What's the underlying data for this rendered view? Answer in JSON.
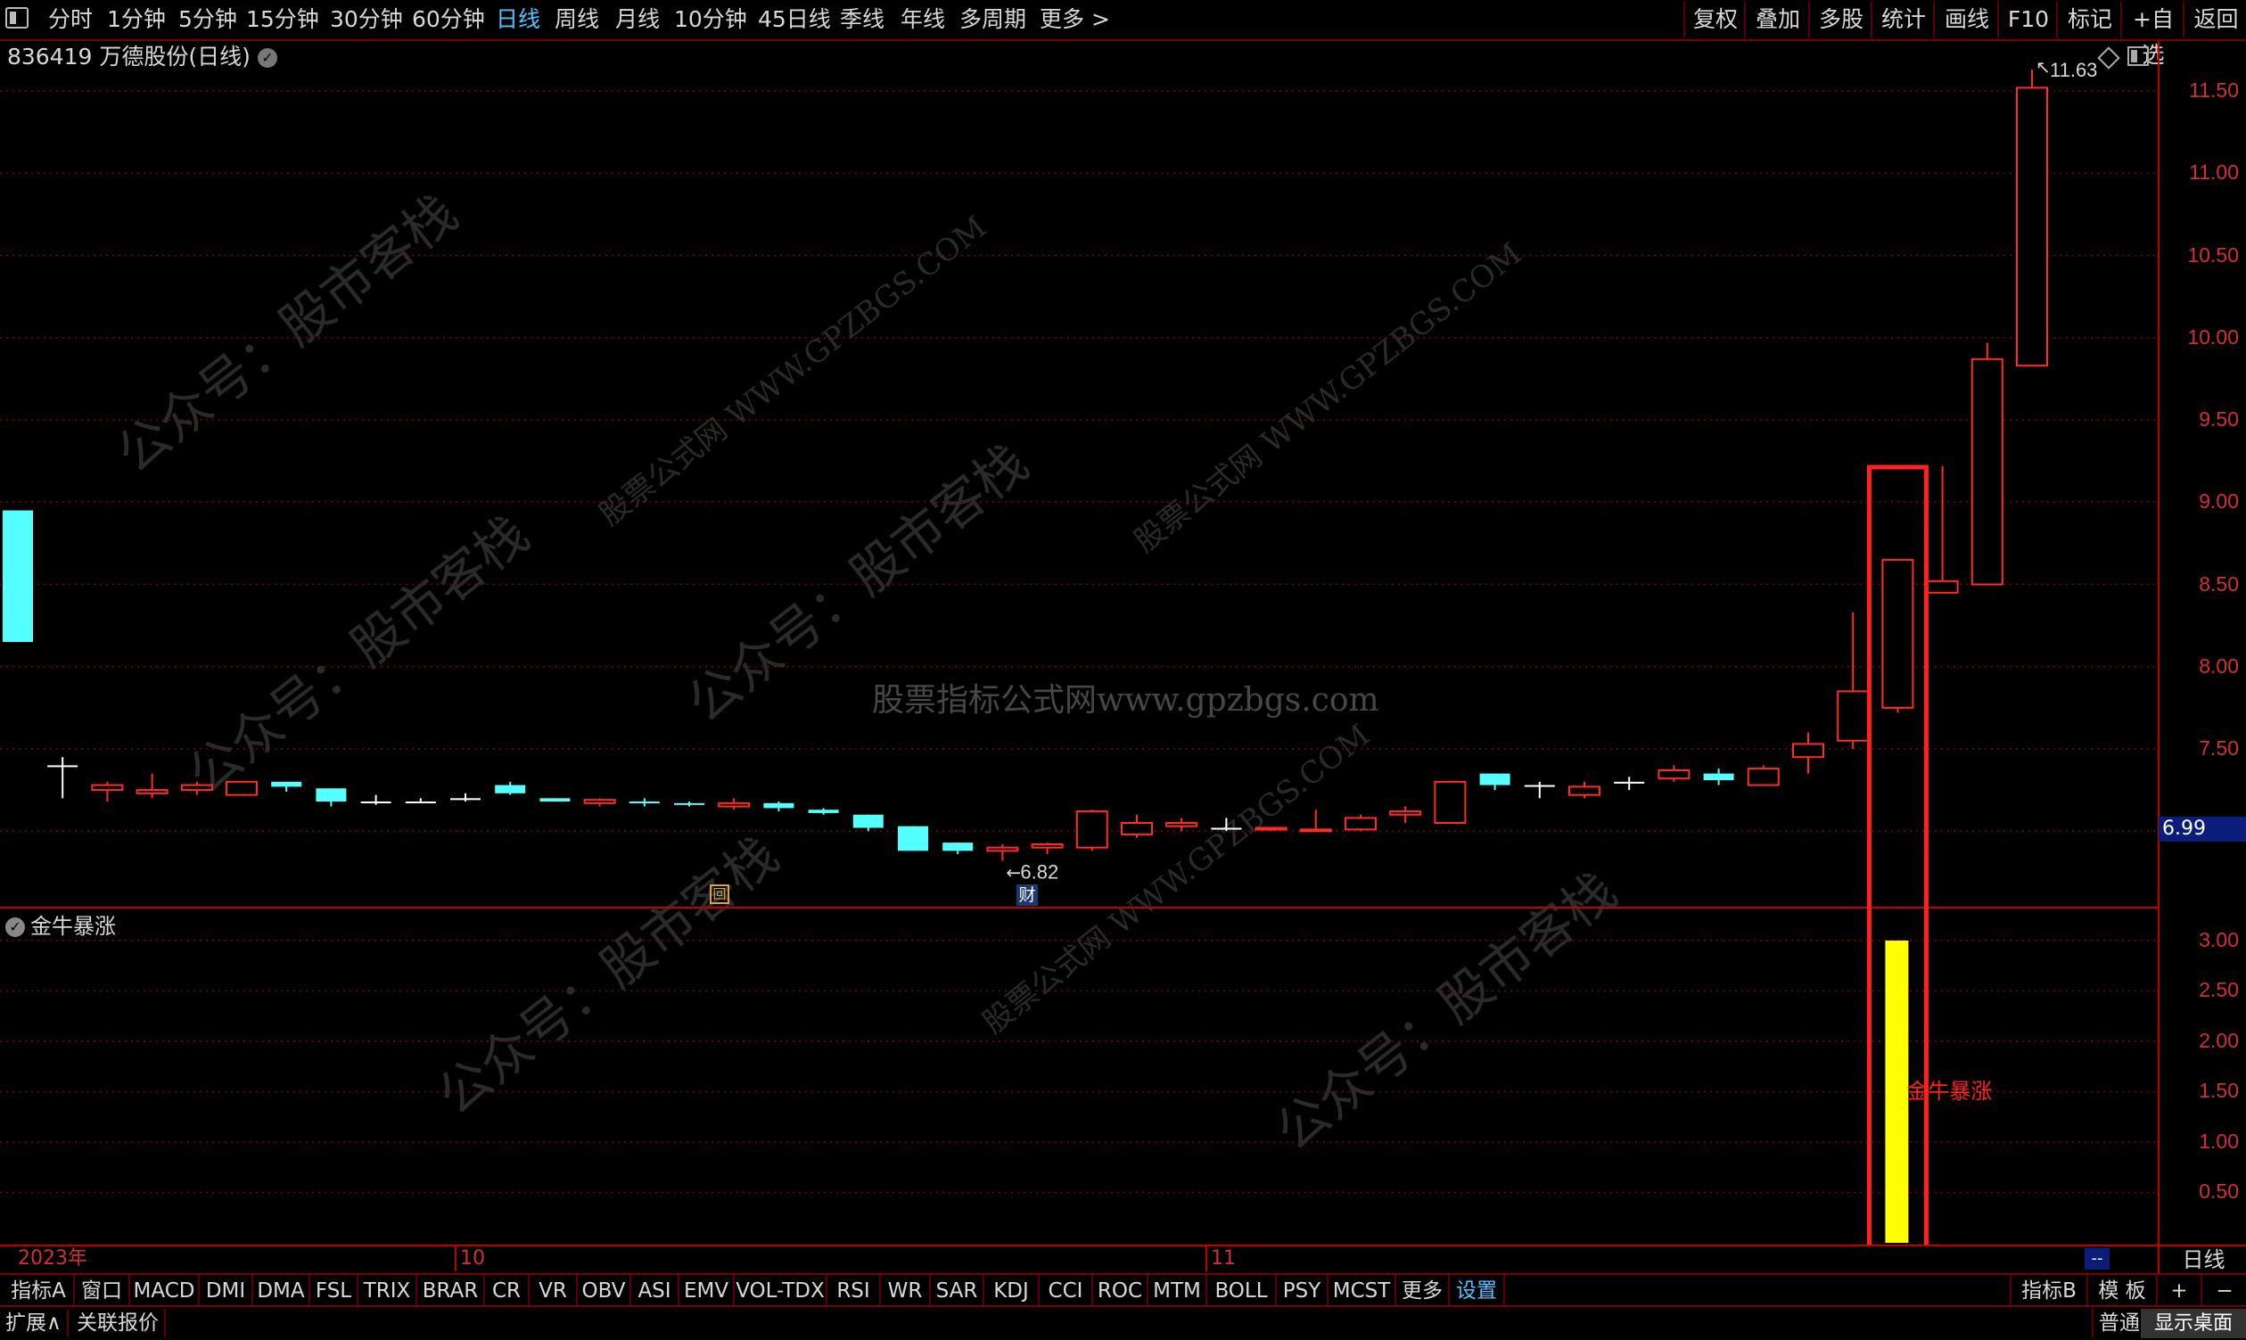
{
  "toolbar": {
    "periods": [
      "分时",
      "1分钟",
      "5分钟",
      "15分钟",
      "30分钟",
      "60分钟",
      "日线",
      "周线",
      "月线",
      "10分钟",
      "45日线",
      "季线",
      "年线",
      "多周期",
      "更多 >"
    ],
    "active_period": "日线",
    "right_buttons": [
      "复权",
      "叠加",
      "多股",
      "统计",
      "画线",
      "F10",
      "标记",
      "+自选",
      "返回"
    ]
  },
  "stock": {
    "title": "836419 万德股份(日线)",
    "dropdown_glyph": "✓"
  },
  "price_axis": {
    "labels": [
      "11.50",
      "11.00",
      "10.50",
      "10.00",
      "9.50",
      "9.00",
      "8.50",
      "8.00",
      "7.50",
      "7.00"
    ],
    "current_price": "6.99"
  },
  "annotations": {
    "high_label": "11.63",
    "low_label": "6.82",
    "marker_hui": "回",
    "marker_cai": "财"
  },
  "indicator": {
    "title": "金牛暴涨",
    "signal_label": "金牛暴涨",
    "axis_labels": [
      "3.00",
      "2.50",
      "2.00",
      "1.50",
      "1.00",
      "0.50"
    ]
  },
  "date_axis": {
    "labels": [
      "2023年",
      "10",
      "11"
    ],
    "right_label": "日线",
    "marker": "--"
  },
  "indicator_tabs": [
    "指标A",
    "窗口",
    "MACD",
    "DMI",
    "DMA",
    "FSL",
    "TRIX",
    "BRAR",
    "CR",
    "VR",
    "OBV",
    "ASI",
    "EMV",
    "VOL-TDX",
    "RSI",
    "WR",
    "SAR",
    "KDJ",
    "CCI",
    "ROC",
    "MTM",
    "BOLL",
    "PSY",
    "MCST",
    "更多",
    "设置"
  ],
  "active_tab": "设置",
  "indicator_tabs_right": [
    "指标B",
    "模 板",
    "+",
    "−"
  ],
  "status": {
    "items": [
      "扩展∧",
      "关联报价"
    ],
    "right_fragment": "普通",
    "show_desktop": "显示桌面"
  },
  "watermarks": {
    "center": "股票指标公式网www.gpzbgs.com",
    "wechat": "公众号：股市客栈",
    "site_cn": "股票公式网 WWW.GPZBGS.COM"
  },
  "colors": {
    "up": "#ff2a2a",
    "down": "#54ffff",
    "flat": "#ffffff",
    "signal": "#ffff00",
    "highlight": "#ff2020",
    "grid": "#8a0000",
    "active": "#4fc3ff"
  },
  "chart_data": {
    "type": "candlestick",
    "price_range": [
      6.6,
      11.75
    ],
    "candles": [
      {
        "o": 8.95,
        "h": 8.95,
        "l": 8.15,
        "c": 8.15
      },
      {
        "o": 7.4,
        "h": 7.45,
        "l": 7.2,
        "c": 7.4
      },
      {
        "o": 7.25,
        "h": 7.3,
        "l": 7.18,
        "c": 7.28
      },
      {
        "o": 7.23,
        "h": 7.35,
        "l": 7.2,
        "c": 7.25
      },
      {
        "o": 7.25,
        "h": 7.3,
        "l": 7.22,
        "c": 7.28
      },
      {
        "o": 7.22,
        "h": 7.3,
        "l": 7.22,
        "c": 7.3
      },
      {
        "o": 7.3,
        "h": 7.3,
        "l": 7.24,
        "c": 7.27
      },
      {
        "o": 7.26,
        "h": 7.26,
        "l": 7.15,
        "c": 7.18
      },
      {
        "o": 7.18,
        "h": 7.22,
        "l": 7.16,
        "c": 7.18
      },
      {
        "o": 7.18,
        "h": 7.2,
        "l": 7.17,
        "c": 7.18
      },
      {
        "o": 7.2,
        "h": 7.23,
        "l": 7.18,
        "c": 7.2
      },
      {
        "o": 7.28,
        "h": 7.3,
        "l": 7.22,
        "c": 7.23
      },
      {
        "o": 7.2,
        "h": 7.2,
        "l": 7.18,
        "c": 7.18
      },
      {
        "o": 7.17,
        "h": 7.2,
        "l": 7.15,
        "c": 7.19
      },
      {
        "o": 7.18,
        "h": 7.2,
        "l": 7.15,
        "c": 7.17
      },
      {
        "o": 7.17,
        "h": 7.18,
        "l": 7.15,
        "c": 7.16
      },
      {
        "o": 7.15,
        "h": 7.2,
        "l": 7.13,
        "c": 7.17
      },
      {
        "o": 7.17,
        "h": 7.18,
        "l": 7.12,
        "c": 7.14
      },
      {
        "o": 7.13,
        "h": 7.14,
        "l": 7.1,
        "c": 7.11
      },
      {
        "o": 7.1,
        "h": 7.1,
        "l": 7.0,
        "c": 7.02
      },
      {
        "o": 7.03,
        "h": 7.03,
        "l": 6.88,
        "c": 6.88
      },
      {
        "o": 6.93,
        "h": 6.93,
        "l": 6.86,
        "c": 6.88
      },
      {
        "o": 6.88,
        "h": 6.92,
        "l": 6.82,
        "c": 6.9
      },
      {
        "o": 6.9,
        "h": 6.93,
        "l": 6.86,
        "c": 6.92
      },
      {
        "o": 6.9,
        "h": 7.13,
        "l": 6.88,
        "c": 7.12
      },
      {
        "o": 6.98,
        "h": 7.1,
        "l": 6.96,
        "c": 7.05
      },
      {
        "o": 7.03,
        "h": 7.08,
        "l": 7.0,
        "c": 7.05
      },
      {
        "o": 7.02,
        "h": 7.08,
        "l": 7.0,
        "c": 7.02
      },
      {
        "o": 7.01,
        "h": 7.02,
        "l": 7.0,
        "c": 7.02
      },
      {
        "o": 7.0,
        "h": 7.13,
        "l": 7.0,
        "c": 7.01
      },
      {
        "o": 7.01,
        "h": 7.1,
        "l": 7.0,
        "c": 7.08
      },
      {
        "o": 7.1,
        "h": 7.15,
        "l": 7.05,
        "c": 7.12
      },
      {
        "o": 7.05,
        "h": 7.3,
        "l": 7.05,
        "c": 7.3
      },
      {
        "o": 7.35,
        "h": 7.35,
        "l": 7.25,
        "c": 7.28
      },
      {
        "o": 7.28,
        "h": 7.3,
        "l": 7.2,
        "c": 7.28
      },
      {
        "o": 7.22,
        "h": 7.3,
        "l": 7.2,
        "c": 7.27
      },
      {
        "o": 7.3,
        "h": 7.33,
        "l": 7.25,
        "c": 7.3
      },
      {
        "o": 7.32,
        "h": 7.4,
        "l": 7.3,
        "c": 7.37
      },
      {
        "o": 7.35,
        "h": 7.38,
        "l": 7.28,
        "c": 7.31
      },
      {
        "o": 7.28,
        "h": 7.4,
        "l": 7.28,
        "c": 7.38
      },
      {
        "o": 7.45,
        "h": 7.6,
        "l": 7.35,
        "c": 7.53
      },
      {
        "o": 7.55,
        "h": 8.33,
        "l": 7.5,
        "c": 7.85
      },
      {
        "o": 7.75,
        "h": 8.65,
        "l": 7.72,
        "c": 8.65
      },
      {
        "o": 8.45,
        "h": 9.22,
        "l": 8.45,
        "c": 8.52
      },
      {
        "o": 8.5,
        "h": 9.97,
        "l": 8.5,
        "c": 9.87
      },
      {
        "o": 9.83,
        "h": 11.63,
        "l": 9.83,
        "c": 11.52
      }
    ],
    "highlight_candle_index": 42,
    "signal": {
      "value": 3.0,
      "candle_index": 42,
      "axis_range": [
        0,
        3.15
      ]
    }
  }
}
